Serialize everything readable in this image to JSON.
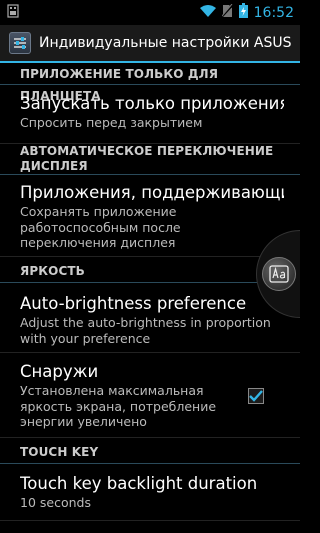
{
  "status_bar": {
    "time": "16:52",
    "icons": [
      "usb-icon",
      "wifi-icon",
      "no-sim-icon",
      "battery-icon"
    ]
  },
  "action_bar": {
    "title": "Индивидуальные настройки ASUS",
    "icon": "settings-sliders-icon"
  },
  "sections": {
    "tablet": {
      "header": "ПРИЛОЖЕНИЕ ТОЛЬКО ДЛЯ ПЛАНШЕТА"
    },
    "tablet_item": {
      "title": "Запускать только приложения",
      "summary": "Спросить перед закрытием"
    },
    "auto_switch": {
      "header": "АВТОМАТИЧЕСКОЕ ПЕРЕКЛЮЧЕНИЕ ДИСПЛЕЯ"
    },
    "auto_switch_item": {
      "title": "Приложения, поддерживающие",
      "summary": "Сохранять приложение работоспособным после переключения дисплея"
    },
    "brightness": {
      "header": "ЯРКОСТЬ"
    },
    "brightness_item": {
      "title": "Auto-brightness preference",
      "summary": "Adjust the auto-brightness in proportion with your preference"
    },
    "outdoor_item": {
      "title": "Снаружи",
      "summary": "Установлена максимальная яркость экрана, потребление энергии увеличено",
      "checked": true
    },
    "touch_key": {
      "header": "TOUCH KEY"
    },
    "touch_key_item": {
      "title": "Touch key backlight duration",
      "summary": "10 seconds"
    }
  },
  "colors": {
    "accent": "#33b5e5",
    "background": "#000000",
    "summary_text": "#bbbbbb"
  }
}
